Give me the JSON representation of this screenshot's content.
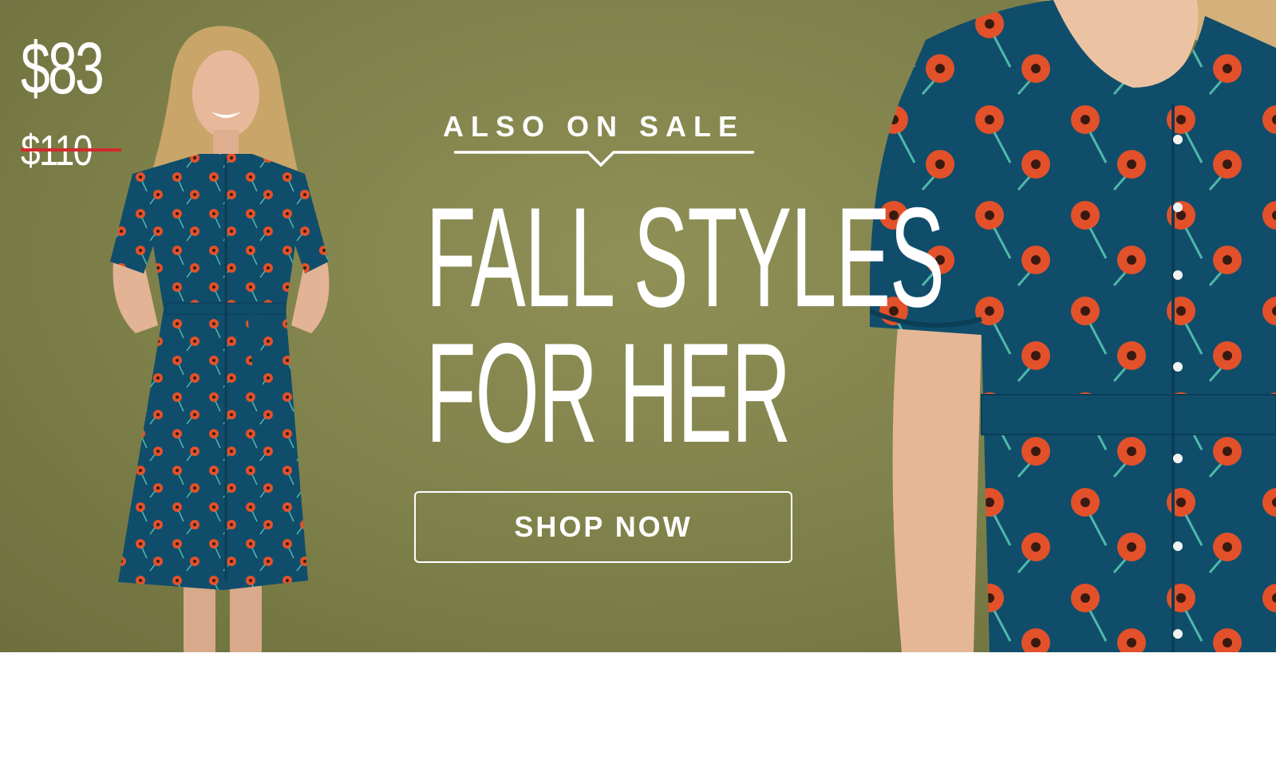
{
  "promo": {
    "price_current": "$83",
    "price_original": "$110",
    "eyebrow": "ALSO ON SALE",
    "headline_line1": "FALL STYLES",
    "headline_line2": "FOR HER",
    "cta_label": "SHOP NOW"
  },
  "colors": {
    "background": "#7e804a",
    "text": "#ffffff",
    "strike": "#d22a2a",
    "dress": "#0f4d6b",
    "flower": "#e2512a"
  },
  "images": {
    "left": "model-full-length-photo",
    "right": "dress-closeup-photo"
  }
}
